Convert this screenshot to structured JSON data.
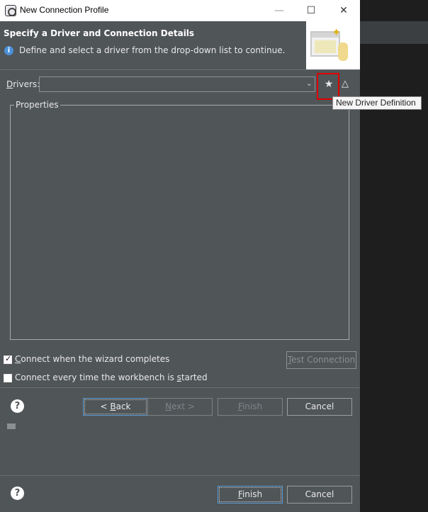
{
  "window": {
    "title": "New Connection Profile",
    "controls": {
      "minimize": "—",
      "maximize": "☐",
      "close": "✕"
    }
  },
  "header": {
    "title": "Specify a Driver and Connection Details",
    "description": "Define and select a driver from the drop-down list to continue.",
    "info_icon": "info-icon",
    "wizard_image": "wizard-banner-image"
  },
  "drivers": {
    "label_mnemonic": "D",
    "label_rest": "rivers:",
    "selected_value": "",
    "new_driver_tooltip": "New Driver Definition",
    "new_driver_icon": "new-driver-icon",
    "edit_driver_icon": "edit-driver-icon"
  },
  "properties": {
    "legend": "Properties"
  },
  "options": {
    "connect_on_complete": {
      "checked": true,
      "mnemonic": "C",
      "label_rest": "onnect when the wizard completes"
    },
    "connect_every_time": {
      "checked": false,
      "label_before": "Connect every time the workbench is ",
      "mnemonic": "s",
      "label_after": "tarted"
    },
    "test_connection": {
      "mnemonic": "T",
      "label_rest": "est Connection"
    }
  },
  "buttons": {
    "back": {
      "prefix": "< ",
      "mnemonic": "B",
      "rest": "ack"
    },
    "next": {
      "mnemonic": "N",
      "rest": "ext >"
    },
    "finish": {
      "mnemonic": "F",
      "rest": "inish"
    },
    "cancel": "Cancel",
    "help": "?"
  },
  "underlying_dialog": {
    "buttons": {
      "finish": {
        "mnemonic": "F",
        "rest": "inish"
      },
      "cancel": "Cancel",
      "help": "?"
    }
  },
  "colors": {
    "dialog_bg": "#505558",
    "titlebar_bg": "#ffffff",
    "highlight": "#e00000",
    "focus_border": "#5a9bd5"
  }
}
